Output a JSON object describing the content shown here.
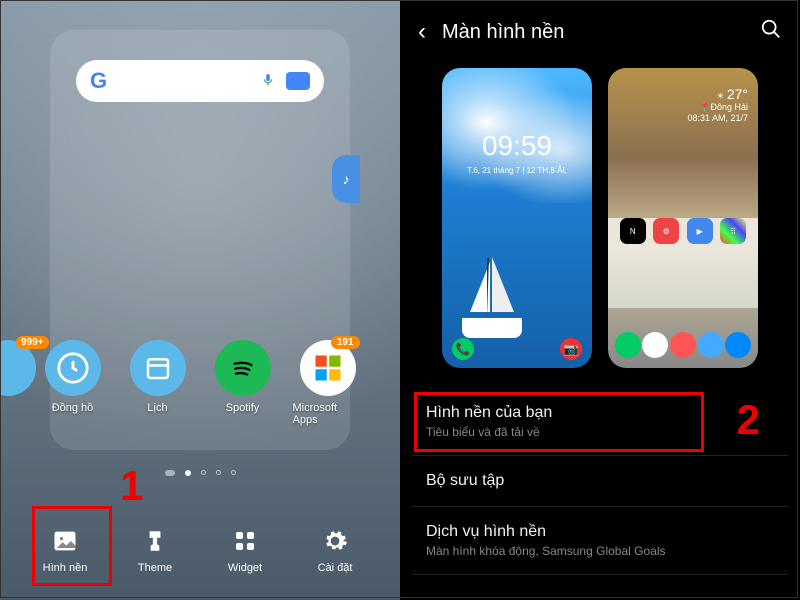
{
  "left": {
    "search": {
      "logo": "G",
      "placeholder": ""
    },
    "volume_icon": "♪",
    "apps": [
      {
        "name": "Đồng hồ",
        "icon_name": "clock-icon",
        "badge": null
      },
      {
        "name": "Lịch",
        "icon_name": "calendar-icon",
        "badge": null
      },
      {
        "name": "Spotify",
        "icon_name": "spotify-icon",
        "badge": null
      },
      {
        "name": "Microsoft Apps",
        "icon_name": "microsoft-icon",
        "badge": "191"
      }
    ],
    "partial_badge": "999+",
    "bottom": [
      {
        "label": "Hình nền",
        "icon": "image-icon"
      },
      {
        "label": "Theme",
        "icon": "brush-icon"
      },
      {
        "label": "Widget",
        "icon": "grid-icon"
      },
      {
        "label": "Cài đặt",
        "icon": "gear-icon"
      }
    ],
    "callout": "1"
  },
  "right": {
    "title": "Màn hình nền",
    "lock_preview": {
      "time": "09:59",
      "date": "T.6, 21 tháng 7 | 12 TH.8 ÂL"
    },
    "home_preview": {
      "temp": "27°",
      "location": "Đông Hải",
      "ts": "08:31 AM, 21/7"
    },
    "list": [
      {
        "title": "Hình nền của bạn",
        "sub": "Tiêu biểu và đã tải về"
      },
      {
        "title": "Bộ sưu tập",
        "sub": ""
      },
      {
        "title": "Dịch vụ hình nền",
        "sub": "Màn hình khóa động, Samsung Global Goals"
      }
    ],
    "callout": "2"
  }
}
